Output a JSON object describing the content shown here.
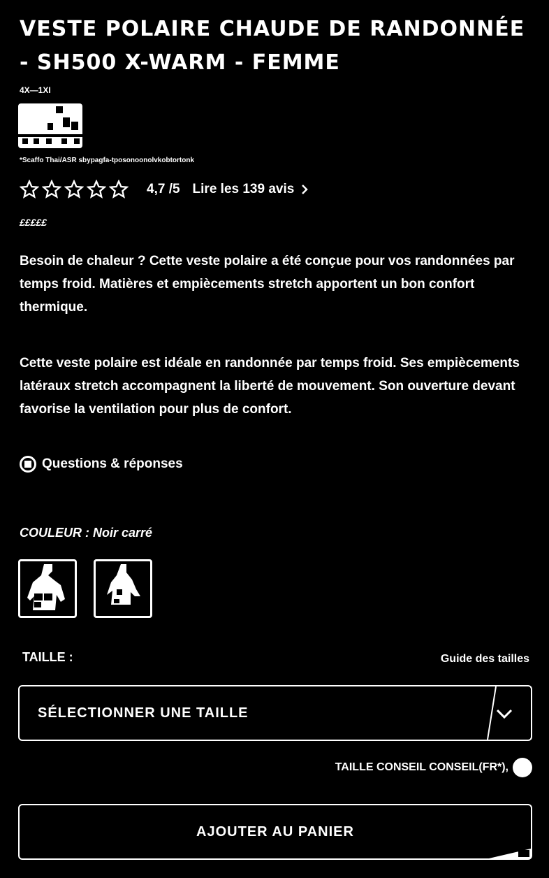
{
  "product": {
    "title": "Veste polaire chaude de randonnée - SH500 X-Warm - Femme",
    "ref": "4X—1XI",
    "tagline": "*Scaffo Thai/ASR sbypagfa-tposonoonolvkobtortonk",
    "rating_value": "4,7 /5",
    "reviews_link": "Lire les 139 avis",
    "stars_filled": 5,
    "stars_total": 5,
    "price": "£££££",
    "description_1": "Besoin de chaleur ? Cette veste polaire a été conçue pour vos randonnées par temps froid. Matières et empiècements stretch apportent un bon confort thermique.",
    "description_2": "Cette veste polaire est idéale en randonnée par temps froid. Ses empiècements latéraux stretch accompagnent la liberté de mouvement. Son ouverture devant favorise la ventilation pour plus de confort.",
    "more_link": "Questions & réponses"
  },
  "colors": {
    "label": "COULEUR : Noir carré",
    "swatches": [
      "swatch-black-jacket",
      "swatch-navy-jacket"
    ]
  },
  "size": {
    "label": "TAILLE :",
    "guide_link": "Guide des tailles",
    "select_placeholder": "Sélectionner une taille",
    "fit_text": "TAILLE CONSEIL CONSEIL(FR*),"
  },
  "cta": {
    "add_to_cart": "Ajouter au panier"
  },
  "icons": {
    "star": "star-outline-icon",
    "chevron_right": "chevron-right-icon",
    "chevron_down": "chevron-down-icon",
    "info": "info-circle-icon"
  }
}
